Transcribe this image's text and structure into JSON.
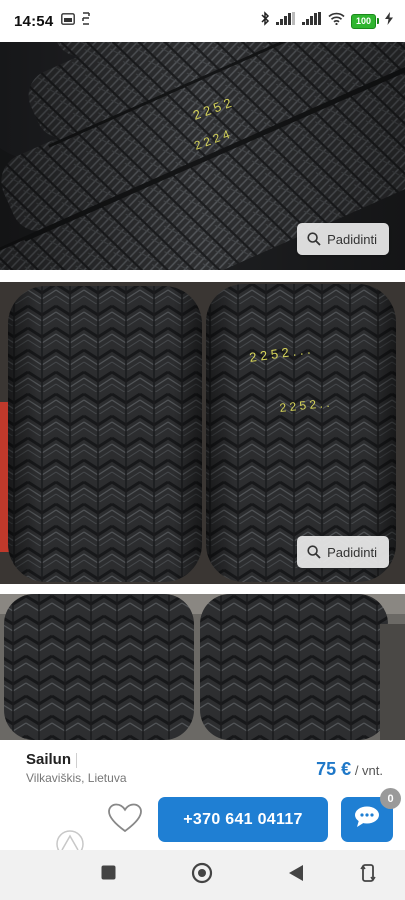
{
  "status_bar": {
    "time": "14:54",
    "battery": "100"
  },
  "gallery": {
    "enlarge_label": "Padidinti"
  },
  "listing": {
    "brand": "Sailun",
    "location": "Vilkaviškis, Lietuva",
    "price": "75 €",
    "price_unit": "/ vnt."
  },
  "actions": {
    "phone": "+370 641 04117",
    "chat_badge": "0"
  },
  "colors": {
    "accent": "#1f7fd3",
    "price": "#1f78c8",
    "battery": "#2fb52f"
  },
  "icons": [
    "photo-icon",
    "sim-icon",
    "bluetooth-icon",
    "signal-icon",
    "wifi-icon",
    "battery-icon",
    "charging-icon",
    "magnifier-icon",
    "heart-icon",
    "chat-icon",
    "recent-apps-icon",
    "home-icon",
    "back-icon",
    "rotate-icon"
  ]
}
